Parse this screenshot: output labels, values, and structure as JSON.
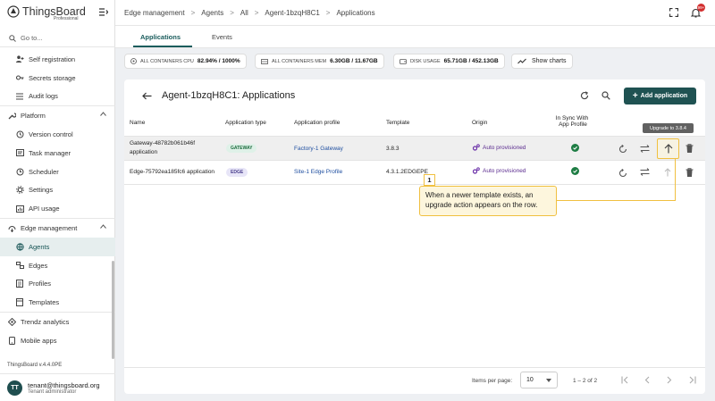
{
  "brand": {
    "name": "ThingsBoard",
    "sub": "Professional"
  },
  "sidebar": {
    "goto": "Go to...",
    "items": [
      {
        "label": "Self registration",
        "icon": "person-add-icon"
      },
      {
        "label": "Secrets storage",
        "icon": "key-icon"
      },
      {
        "label": "Audit logs",
        "icon": "list-icon"
      },
      {
        "label": "Platform",
        "icon": "wrench-icon",
        "section": true
      },
      {
        "label": "Version control",
        "icon": "history-icon"
      },
      {
        "label": "Task manager",
        "icon": "task-icon"
      },
      {
        "label": "Scheduler",
        "icon": "clock-icon"
      },
      {
        "label": "Settings",
        "icon": "gear-icon"
      },
      {
        "label": "API usage",
        "icon": "chart-icon"
      },
      {
        "label": "Edge management",
        "icon": "edge-icon",
        "section": true
      },
      {
        "label": "Agents",
        "icon": "globe-icon",
        "active": true
      },
      {
        "label": "Edges",
        "icon": "edges-icon"
      },
      {
        "label": "Profiles",
        "icon": "profile-icon"
      },
      {
        "label": "Templates",
        "icon": "template-icon"
      },
      {
        "label": "Trendz analytics",
        "icon": "trendz-icon",
        "section": true
      },
      {
        "label": "Mobile apps",
        "icon": "mobile-icon",
        "section": true
      }
    ],
    "version": "ThingsBoard v.4.4.0PE",
    "user": {
      "initials": "TT",
      "email": "tenant@thingsboard.org",
      "role": "Tenant administrator"
    }
  },
  "breadcrumbs": [
    "Edge management",
    "Agents",
    "All",
    "Agent-1bzqH8C1",
    "Applications"
  ],
  "notif_count": "99+",
  "tabs": [
    "Applications",
    "Events"
  ],
  "stats": [
    {
      "label": "ALL CONTAINERS CPU",
      "value": "82.94% / 1000%"
    },
    {
      "label": "ALL CONTAINERS MEM",
      "value": "6.30GB / 11.67GB"
    },
    {
      "label": "DISK USAGE",
      "value": "65.71GB / 452.13GB"
    }
  ],
  "show_charts": "Show charts",
  "card": {
    "title": "Agent-1bzqH8C1: Applications",
    "add_label": "Add application"
  },
  "columns": [
    "Name",
    "Application type",
    "Application profile",
    "Template",
    "Origin",
    "In Sync With",
    "App Profile"
  ],
  "rows": [
    {
      "name1": "Gateway-48782b061b46f",
      "name2": "application",
      "type": "GATEWAY",
      "profile": "Factory-1 Gateway",
      "template": "3.8.3",
      "origin": "Auto provisioned"
    },
    {
      "name1": "Edge-75792ea185fc6 application",
      "name2": "",
      "type": "EDGE",
      "profile": "Site-1 Edge Profile",
      "template": "4.3.1.2EDGEPE",
      "origin": "Auto provisioned"
    }
  ],
  "tooltip": "Upgrade to 3.8.4",
  "callout": {
    "num": "1",
    "text": "When a newer template exists, an upgrade action appears on the row."
  },
  "paginator": {
    "label": "Items per page:",
    "size": "10",
    "range": "1 – 2 of 2"
  },
  "colors": {
    "primary": "#1f5252",
    "accent": "#f0c040"
  }
}
